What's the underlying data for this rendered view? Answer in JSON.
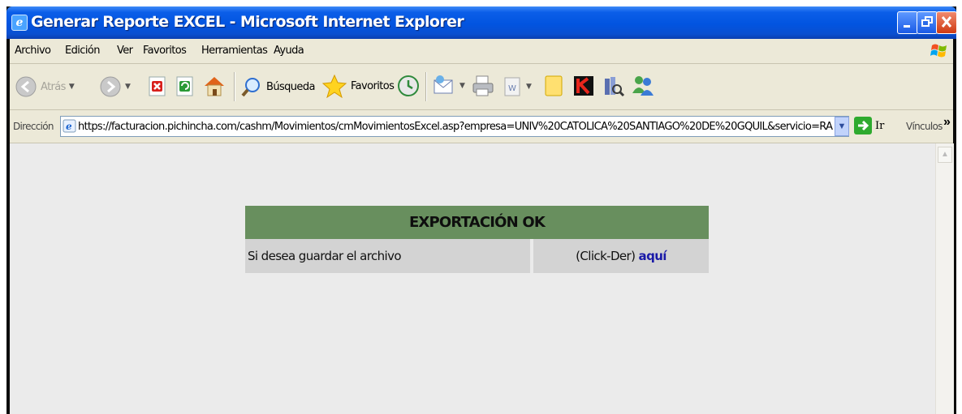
{
  "window": {
    "title": "Generar Reporte EXCEL - Microsoft Internet Explorer"
  },
  "menu": [
    "Archivo",
    "Edición",
    "Ver",
    "Favoritos",
    "Herramientas",
    "Ayuda"
  ],
  "toolbar": {
    "back_label": "Atrás",
    "search_label": "Búsqueda",
    "favorites_label": "Favoritos"
  },
  "address": {
    "label": "Dirección",
    "url": "https://facturacion.pichincha.com/cashm/Movimientos/cmMovimientosExcel.asp?empresa=UNIV%20CATOLICA%20SANTIAGO%20DE%20GQUIL&servicio=RA&estado=",
    "go_label": "Ir",
    "links_label": "Vínculos",
    "links_chevron": "»"
  },
  "report": {
    "header": "EXPORTACIÓN OK",
    "row_text": "Si desea guardar el archivo",
    "click_hint": "(Click-Der)",
    "link_text": "aquí"
  },
  "colors": {
    "header_bg": "#688f5e",
    "row_bg": "#d3d3d3",
    "link": "#1a1aa8"
  }
}
